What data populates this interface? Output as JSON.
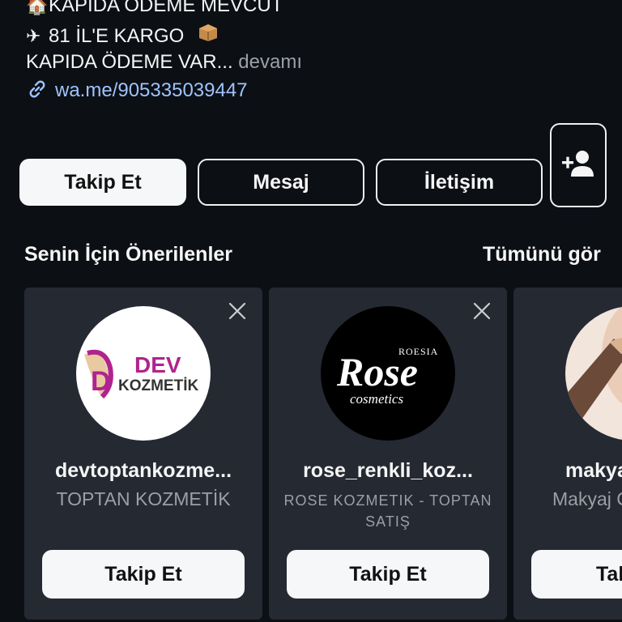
{
  "bio": {
    "line1_icon": "house-icon",
    "line1": "KAPIDA ÖDEME MEVCUT",
    "line2_icon": "airplane-icon",
    "line2": "81 İL'E KARGO",
    "line2_icon_after": "package-icon",
    "line3": "KAPIDA ÖDEME VAR...",
    "line3_more": " devamı",
    "link": "wa.me/905335039447"
  },
  "actions": {
    "follow": "Takip Et",
    "message": "Mesaj",
    "contact": "İletişim",
    "add_user_icon": "add-person-icon"
  },
  "suggestions": {
    "title": "Senin İçin Önerilenler",
    "see_all": "Tümünü gör",
    "cards": [
      {
        "username": "devtoptankozme...",
        "subtitle": "TOPTAN KOZMETİK",
        "follow": "Takip Et",
        "logo_text_1": "DEV",
        "logo_text_2": "KOZMETİK",
        "logo_initial": "D"
      },
      {
        "username": "rose_renkli_koz...",
        "subtitle_line1": "ROSE KOZMETIK - TOPTAN",
        "subtitle_line2": "SATIŞ",
        "follow": "Takip Et",
        "logo_top": "ROESIA",
        "logo_main": "Rose",
        "logo_sub": "cosmetics"
      },
      {
        "username": "makya",
        "subtitle": "Makyaj Ç",
        "follow": "Tak"
      }
    ]
  },
  "colors": {
    "background": "#0c0f14",
    "card": "#252932",
    "link": "#9fc3ff",
    "logo_purple": "#b0238f"
  }
}
